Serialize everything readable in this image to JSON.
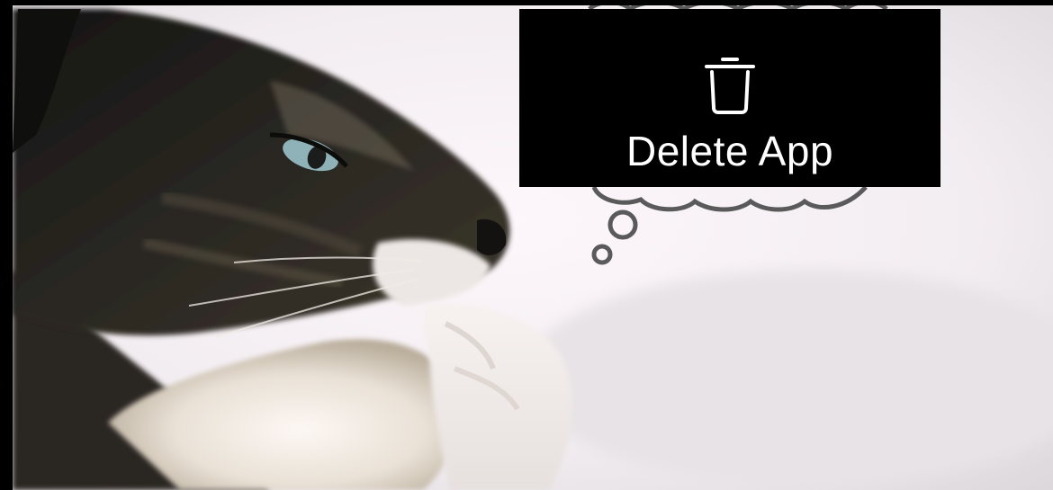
{
  "popup": {
    "label": "Delete App",
    "icon": "trash-icon",
    "background_color": "#000000",
    "text_color": "#ffffff"
  },
  "thought_bubble": {
    "icon": "thought-bubble-icon",
    "stroke_color": "#5a5a5a"
  }
}
